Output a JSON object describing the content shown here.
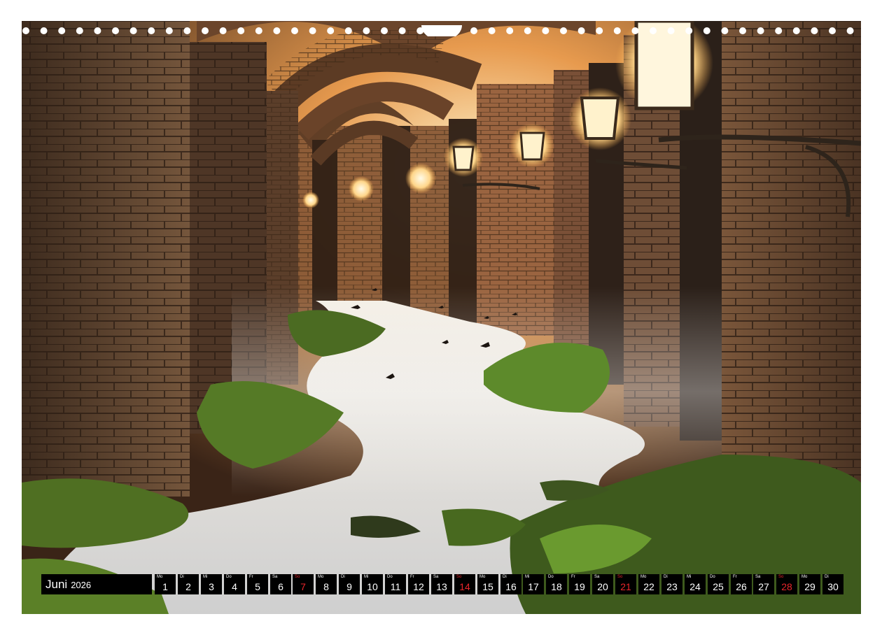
{
  "calendar": {
    "month": "Juni",
    "year": "2026",
    "days": [
      {
        "wd": "Mo",
        "d": "1"
      },
      {
        "wd": "Di",
        "d": "2"
      },
      {
        "wd": "Mi",
        "d": "3"
      },
      {
        "wd": "Do",
        "d": "4"
      },
      {
        "wd": "Fr",
        "d": "5"
      },
      {
        "wd": "Sa",
        "d": "6"
      },
      {
        "wd": "So",
        "d": "7",
        "sun": true
      },
      {
        "wd": "Mo",
        "d": "8"
      },
      {
        "wd": "Di",
        "d": "9"
      },
      {
        "wd": "Mi",
        "d": "10"
      },
      {
        "wd": "Do",
        "d": "11"
      },
      {
        "wd": "Fr",
        "d": "12"
      },
      {
        "wd": "Sa",
        "d": "13"
      },
      {
        "wd": "So",
        "d": "14",
        "sun": true
      },
      {
        "wd": "Mo",
        "d": "15"
      },
      {
        "wd": "Di",
        "d": "16"
      },
      {
        "wd": "Mi",
        "d": "17"
      },
      {
        "wd": "Do",
        "d": "18"
      },
      {
        "wd": "Fr",
        "d": "19"
      },
      {
        "wd": "Sa",
        "d": "20"
      },
      {
        "wd": "So",
        "d": "21",
        "sun": true
      },
      {
        "wd": "Mo",
        "d": "22"
      },
      {
        "wd": "Di",
        "d": "23"
      },
      {
        "wd": "Mi",
        "d": "24"
      },
      {
        "wd": "Do",
        "d": "25"
      },
      {
        "wd": "Fr",
        "d": "26"
      },
      {
        "wd": "Sa",
        "d": "27"
      },
      {
        "wd": "So",
        "d": "28",
        "sun": true
      },
      {
        "wd": "Mo",
        "d": "29"
      },
      {
        "wd": "Di",
        "d": "30"
      }
    ]
  },
  "colors": {
    "cell_bg": "#000000",
    "cell_text": "#ffffff",
    "sunday_text": "#e8262b",
    "brick": "#6b4a32",
    "lamp_glow": "#ffd58a",
    "moss": "#5f8a2a",
    "water": "#dcdcdc"
  }
}
